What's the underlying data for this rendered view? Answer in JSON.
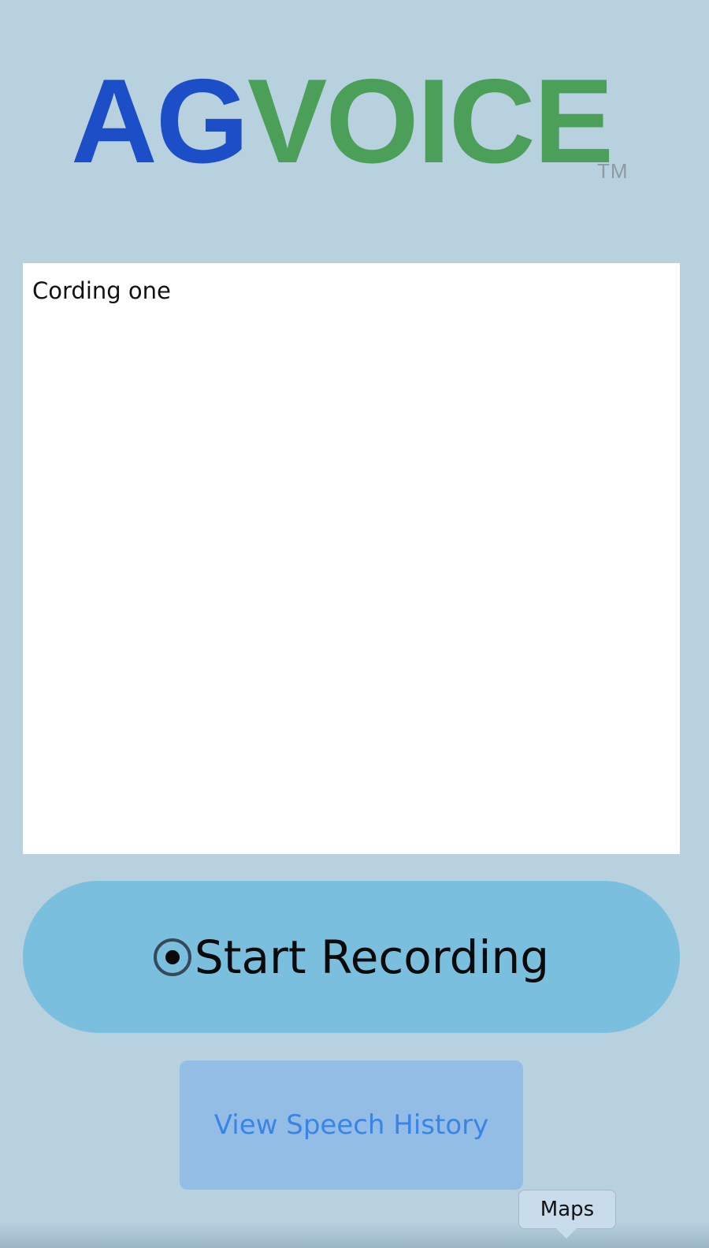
{
  "logo": {
    "part_ag": "AG",
    "part_voice": "VOICE",
    "trademark": "TM",
    "color_ag": "#1c4ec8",
    "color_voice": "#4c9f59"
  },
  "transcript": {
    "value": "Cording one"
  },
  "record_button": {
    "icon": "record-icon",
    "label": "Start Recording"
  },
  "history_button": {
    "label": "View Speech History"
  },
  "tooltip": {
    "label": "Maps"
  },
  "colors": {
    "background": "#b8d1df",
    "record_button": "#7bbfdf",
    "history_button": "#93bde5",
    "link_text": "#3a84e8"
  }
}
